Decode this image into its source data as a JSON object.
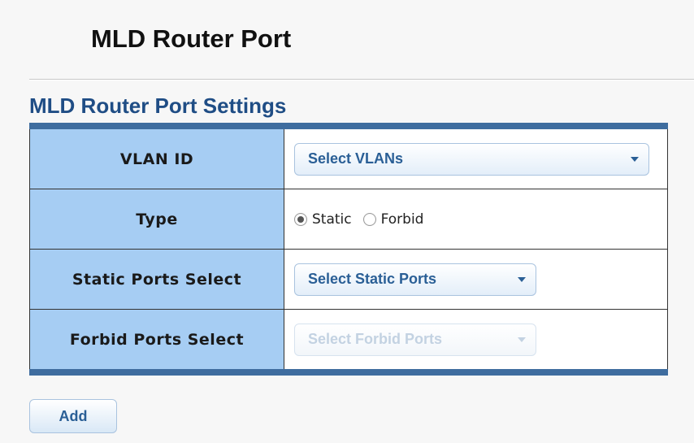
{
  "page": {
    "title": "MLD Router Port",
    "section_title": "MLD Router Port Settings"
  },
  "settings": {
    "vlan_id": {
      "label": "VLAN ID",
      "select_text": "Select VLANs"
    },
    "type": {
      "label": "Type",
      "options": [
        {
          "label": "Static",
          "checked": true
        },
        {
          "label": "Forbid",
          "checked": false
        }
      ]
    },
    "static_ports": {
      "label": "Static Ports Select",
      "select_text": "Select Static Ports"
    },
    "forbid_ports": {
      "label": "Forbid Ports Select",
      "select_text": "Select Forbid Ports",
      "disabled": true
    }
  },
  "actions": {
    "add_label": "Add"
  },
  "colors": {
    "label_bg": "#a6cdf3",
    "table_border": "#3f6d9f",
    "section_title": "#1f4d85",
    "button_text": "#2a5f96"
  },
  "icons": {
    "dropdown": "chevron-down-icon",
    "radio": "radio-icon"
  }
}
